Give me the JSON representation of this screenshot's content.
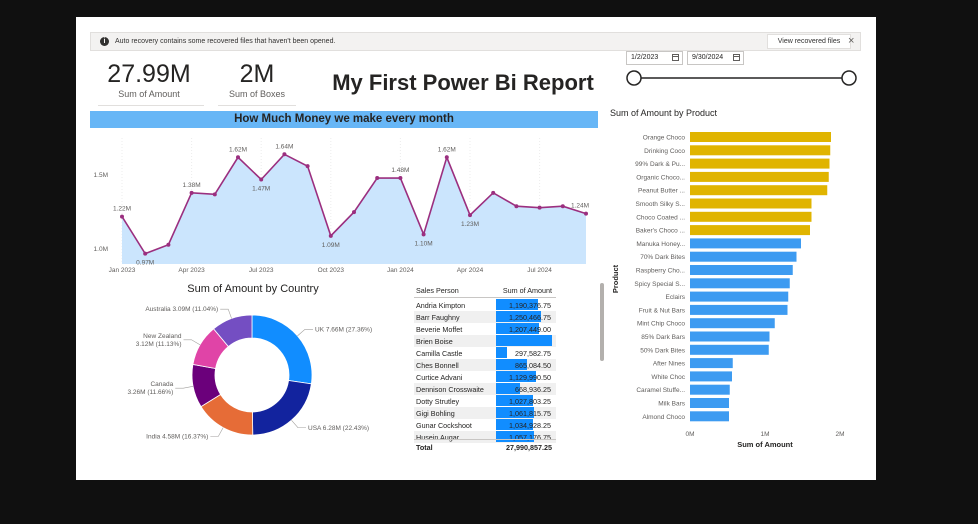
{
  "notice": {
    "message": "Auto recovery contains some recovered files that haven't been opened.",
    "button": "View recovered files",
    "close": "×"
  },
  "kpis": [
    {
      "value": "27.99M",
      "label": "Sum of Amount"
    },
    {
      "value": "2M",
      "label": "Sum of Boxes"
    }
  ],
  "report_title": "My First Power Bi Report",
  "date_slicer": {
    "start": "1/2/2023",
    "end": "9/30/2024"
  },
  "band_title": "How Much Money we make every month",
  "chart_data": [
    {
      "type": "area",
      "title": "",
      "x": [
        "Jan 2023",
        "Feb 2023",
        "Mar 2023",
        "Apr 2023",
        "May 2023",
        "Jun 2023",
        "Jul 2023",
        "Aug 2023",
        "Sep 2023",
        "Oct 2023",
        "Nov 2023",
        "Dec 2023",
        "Jan 2024",
        "Feb 2024",
        "Mar 2024",
        "Apr 2024",
        "May 2024",
        "Jun 2024",
        "Jul 2024",
        "Aug 2024",
        "Sep 2024"
      ],
      "x_tick_labels": [
        "Jan 2023",
        "Apr 2023",
        "Jul 2023",
        "Oct 2023",
        "Jan 2024",
        "Apr 2024",
        "Jul 2024"
      ],
      "values": [
        1.22,
        0.97,
        1.03,
        1.38,
        1.37,
        1.62,
        1.47,
        1.64,
        1.56,
        1.09,
        1.25,
        1.48,
        1.48,
        1.1,
        1.62,
        1.23,
        1.38,
        1.29,
        1.28,
        1.29,
        1.24
      ],
      "data_labels": {
        "0": "1.22M",
        "1": "0.97M",
        "3": "1.38M",
        "5": "1.62M",
        "6": "1.47M",
        "7": "1.64M",
        "9": "1.09M",
        "12": "1.48M",
        "13": "1.10M",
        "14": "1.62M",
        "15": "1.23M",
        "20": "1.24M"
      },
      "y_tick_labels": [
        "1.0M",
        "1.5M"
      ],
      "ylim": [
        0.9,
        1.75
      ],
      "units": "M",
      "colors": {
        "line": "#9b2f7f",
        "area": "#cbe5fd"
      }
    },
    {
      "type": "pie",
      "title": "Sum of Amount by Country",
      "slices": [
        {
          "name": "UK",
          "value": 7.66,
          "label": "UK 7.66M (27.36%)",
          "color": "#118dff"
        },
        {
          "name": "USA",
          "value": 6.28,
          "label": "USA 6.28M (22.43%)",
          "color": "#12239e"
        },
        {
          "name": "India",
          "value": 4.58,
          "label": "India 4.58M (16.37%)",
          "color": "#e66c37"
        },
        {
          "name": "Canada",
          "value": 3.26,
          "label_lines": [
            "Canada",
            "3.26M (11.66%)"
          ],
          "color": "#6b007b"
        },
        {
          "name": "New Zealand",
          "value": 3.12,
          "label_lines": [
            "New Zealand",
            "3.12M (11.13%)"
          ],
          "color": "#e044a7"
        },
        {
          "name": "Australia",
          "value": 3.09,
          "label": "Australia 3.09M (11.04%)",
          "color": "#744ec2"
        }
      ]
    },
    {
      "type": "bar",
      "title": "Sum of Amount by Product",
      "xlabel": "Sum of Amount",
      "ylabel": "Product",
      "x_tick_labels": [
        "0M",
        "1M",
        "2M"
      ],
      "xlim": [
        0,
        2
      ],
      "categories": [
        "Orange Choco",
        "Drinking Coco",
        "99% Dark & Pu...",
        "Organic Choco...",
        "Peanut Butter ...",
        "Smooth Silky S...",
        "Choco Coated ...",
        "Baker's Choco ...",
        "Manuka Honey...",
        "70% Dark Bites",
        "Raspberry Cho...",
        "Spicy Special S...",
        "Eclairs",
        "Fruit & Nut Bars",
        "Mint Chip Choco",
        "85% Dark Bars",
        "50% Dark Bites",
        "After Nines",
        "White Choc",
        "Caramel Stuffe...",
        "Milk Bars",
        "Almond Choco"
      ],
      "values": [
        1.88,
        1.87,
        1.86,
        1.85,
        1.83,
        1.62,
        1.62,
        1.6,
        1.48,
        1.42,
        1.37,
        1.33,
        1.31,
        1.3,
        1.13,
        1.06,
        1.05,
        0.57,
        0.56,
        0.53,
        0.52,
        0.52
      ],
      "highlight_count": 8,
      "colors": {
        "highlight": "#e0b400",
        "default": "#3d9bf1"
      }
    }
  ],
  "sales_table": {
    "headers": [
      "Sales Person",
      "Sum of Amount"
    ],
    "rows": [
      {
        "name": "Andria Kimpton",
        "amount": "1,190,376.75",
        "value": 1190376.75
      },
      {
        "name": "Barr Faughny",
        "amount": "1,250,466.75",
        "value": 1250466.75
      },
      {
        "name": "Beverie Moffet",
        "amount": "1,207,449.00",
        "value": 1207449.0
      },
      {
        "name": "Brien Boise",
        "amount": "",
        "value": 1580000
      },
      {
        "name": "Camilla Castle",
        "amount": "297,582.75",
        "value": 297582.75
      },
      {
        "name": "Ches Bonnell",
        "amount": "865,084.50",
        "value": 865084.5
      },
      {
        "name": "Curtice Advani",
        "amount": "1,129,990.50",
        "value": 1129990.5
      },
      {
        "name": "Dennison Crosswaite",
        "amount": "668,936.25",
        "value": 668936.25
      },
      {
        "name": "Dotty Strutley",
        "amount": "1,027,803.25",
        "value": 1027803.25
      },
      {
        "name": "Gigi Bohling",
        "amount": "1,061,815.75",
        "value": 1061815.75
      },
      {
        "name": "Gunar Cockshoot",
        "amount": "1,034,928.25",
        "value": 1034928.25
      },
      {
        "name": "Husein Augar",
        "amount": "1,057,176.75",
        "value": 1057176.75
      }
    ],
    "total_label": "Total",
    "total_amount": "27,990,857.25"
  }
}
